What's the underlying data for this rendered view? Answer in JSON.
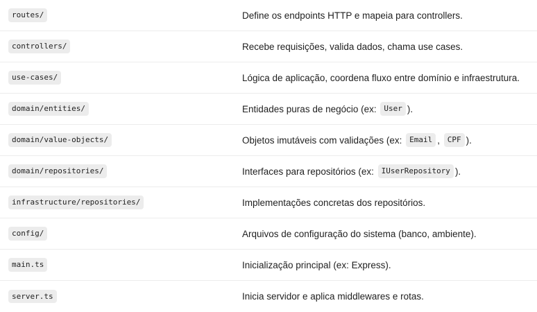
{
  "rows": [
    {
      "path": "routes/",
      "description": [
        {
          "type": "text",
          "value": "Define os endpoints HTTP e mapeia para controllers."
        }
      ]
    },
    {
      "path": "controllers/",
      "description": [
        {
          "type": "text",
          "value": "Recebe requisições, valida dados, chama use cases."
        }
      ]
    },
    {
      "path": "use-cases/",
      "description": [
        {
          "type": "text",
          "value": "Lógica de aplicação, coordena fluxo entre domínio e infraestrutura."
        }
      ]
    },
    {
      "path": "domain/entities/",
      "description": [
        {
          "type": "text",
          "value": "Entidades puras de negócio (ex: "
        },
        {
          "type": "code",
          "value": "User"
        },
        {
          "type": "text",
          "value": ")."
        }
      ]
    },
    {
      "path": "domain/value-objects/",
      "description": [
        {
          "type": "text",
          "value": "Objetos imutáveis com validações (ex: "
        },
        {
          "type": "code",
          "value": "Email"
        },
        {
          "type": "text",
          "value": ", "
        },
        {
          "type": "code",
          "value": "CPF"
        },
        {
          "type": "text",
          "value": ")."
        }
      ]
    },
    {
      "path": "domain/repositories/",
      "description": [
        {
          "type": "text",
          "value": "Interfaces para repositórios (ex: "
        },
        {
          "type": "code",
          "value": "IUserRepository"
        },
        {
          "type": "text",
          "value": ")."
        }
      ]
    },
    {
      "path": "infrastructure/repositories/",
      "description": [
        {
          "type": "text",
          "value": "Implementações concretas dos repositórios."
        }
      ]
    },
    {
      "path": "config/",
      "description": [
        {
          "type": "text",
          "value": "Arquivos de configuração do sistema (banco, ambiente)."
        }
      ]
    },
    {
      "path": "main.ts",
      "description": [
        {
          "type": "text",
          "value": "Inicialização principal (ex: Express)."
        }
      ]
    },
    {
      "path": "server.ts",
      "description": [
        {
          "type": "text",
          "value": "Inicia servidor e aplica middlewares e rotas."
        }
      ]
    }
  ]
}
